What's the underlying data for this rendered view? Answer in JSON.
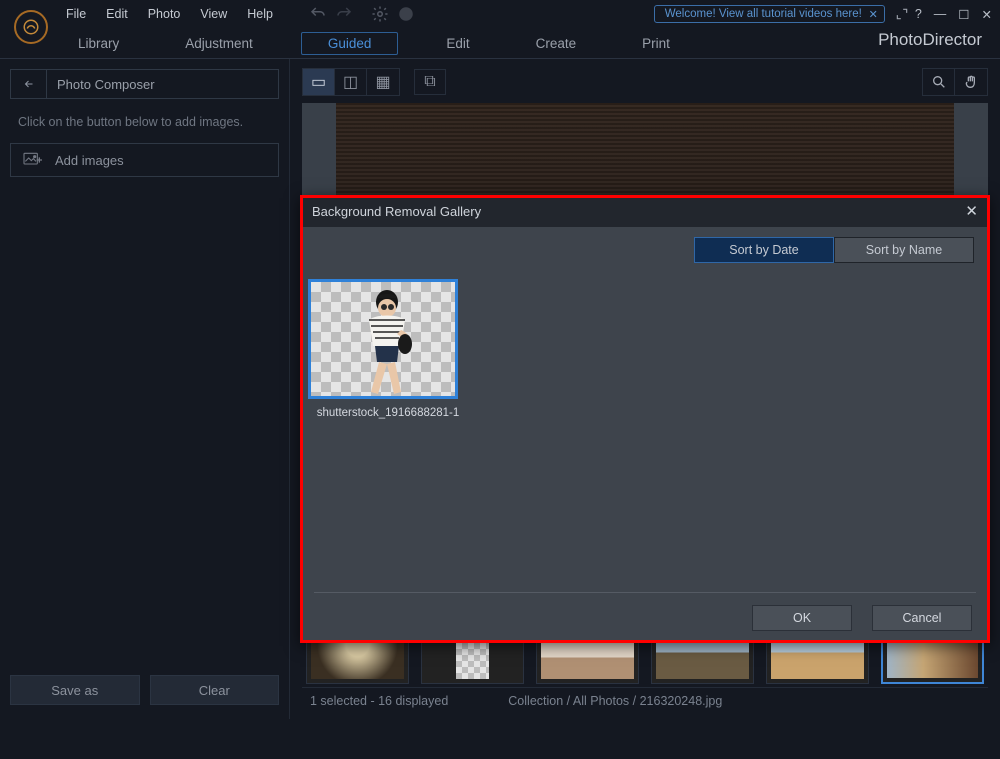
{
  "app_name": "PhotoDirector",
  "welcome_text": "Welcome! View all tutorial videos here!",
  "menu": {
    "file": "File",
    "edit": "Edit",
    "photo": "Photo",
    "view": "View",
    "help": "Help"
  },
  "tabs": {
    "library": "Library",
    "adjustment": "Adjustment",
    "guided": "Guided",
    "edit": "Edit",
    "create": "Create",
    "print": "Print"
  },
  "sidebar": {
    "title": "Photo Composer",
    "hint": "Click on the button below to add images.",
    "add_label": "Add images",
    "save_as": "Save as",
    "clear": "Clear"
  },
  "dialog": {
    "title": "Background Removal Gallery",
    "sort_date": "Sort by Date",
    "sort_name": "Sort by Name",
    "item_caption": "shutterstock_1916688281-1",
    "ok": "OK",
    "cancel": "Cancel"
  },
  "status": {
    "left": "1 selected - 16 displayed",
    "right": "Collection / All Photos / 216320248.jpg"
  }
}
